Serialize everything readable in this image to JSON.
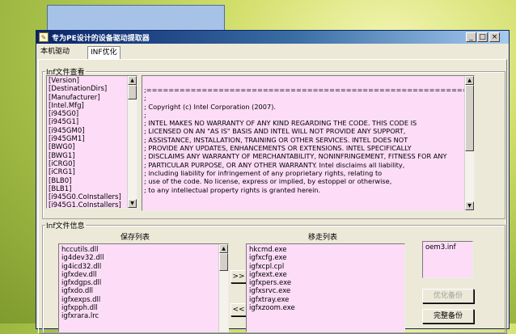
{
  "window": {
    "title": "专为PE设计的设备驱动提取器",
    "min_glyph": "_",
    "max_glyph": "□",
    "close_glyph": "×"
  },
  "tabs": [
    {
      "label": "本机驱动",
      "active": false
    },
    {
      "label": "INF优化",
      "active": true
    }
  ],
  "inf_view": {
    "group_label": "Inf文件查看",
    "sections": [
      "[Version]",
      "[DestinationDirs]",
      "[Manufacturer]",
      "[Intel.Mfg]",
      "[i945G0]",
      "[i945G1]",
      "[i945GM0]",
      "[i945GM1]",
      "[BWG0]",
      "[BWG1]",
      "[iCRG0]",
      "[iCRG1]",
      "[BLB0]",
      "[BLB1]",
      "[i945G0.CoInstallers]",
      "[i945G1.CoInstallers]"
    ],
    "content_lines": [
      ";=======================================================================================",
      ";",
      "; Copyright (c) Intel Corporation (2007).",
      ";",
      "; INTEL MAKES NO WARRANTY OF ANY KIND REGARDING THE CODE.  THIS CODE IS",
      "; LICENSED ON AN \"AS IS\" BASIS AND INTEL WILL NOT PROVIDE ANY SUPPORT,",
      "; ASSISTANCE, INSTALLATION, TRAINING OR OTHER SERVICES.  INTEL DOES NOT",
      "; PROVIDE ANY UPDATES, ENHANCEMENTS OR EXTENSIONS.  INTEL SPECIFICALLY",
      "; DISCLAIMS ANY WARRANTY OF MERCHANTABILITY, NONINFRINGEMENT, FITNESS FOR ANY",
      "; PARTICULAR PURPOSE, OR ANY OTHER WARRANTY.  Intel disclaims all liability,",
      "; including liability for infringement of any proprietary rights, relating to",
      "; use of the code. No license, express or implied, by estoppel or otherwise,",
      "; to any intellectual property rights is granted herein."
    ]
  },
  "inf_info": {
    "group_label": "Inf文件信息",
    "keep_list_header": "保存列表",
    "move_list_header": "移走列表",
    "keep_list": [
      "hccutils.dll",
      "ig4dev32.dll",
      "ig4icd32.dll",
      "igfxdev.dll",
      "igfxdgps.dll",
      "igfxdo.dll",
      "igfxexps.dll",
      "igfxpph.dll",
      "igfxrara.lrc"
    ],
    "move_list": [
      "hkcmd.exe",
      "igfxcfg.exe",
      "igfxcpl.cpl",
      "igfxext.exe",
      "igfxpers.exe",
      "igfxsrvc.exe",
      "igfxtray.exe",
      "igfxzoom.exe"
    ],
    "move_right_label": ">>",
    "move_left_label": "<<",
    "inf_files": [
      "oem3.inf"
    ],
    "optimize_backup_label": "优化备份",
    "full_backup_label": "完整备份"
  }
}
